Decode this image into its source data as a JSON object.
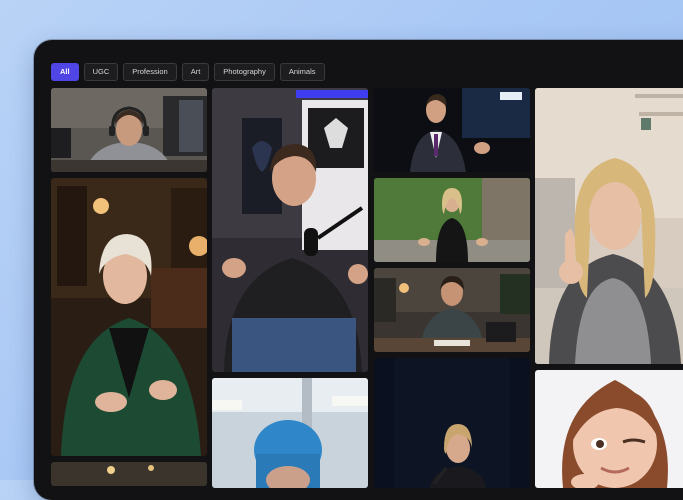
{
  "filters": [
    {
      "label": "All",
      "active": true
    },
    {
      "label": "UGC",
      "active": false
    },
    {
      "label": "Profession",
      "active": false
    },
    {
      "label": "Art",
      "active": false
    },
    {
      "label": "Photography",
      "active": false
    },
    {
      "label": "Animals",
      "active": false
    }
  ],
  "gallery": {
    "column_1": [
      "man-with-headset-at-desk",
      "older-woman-in-green-blazer-in-library",
      "dim-interior-bottom"
    ],
    "column_2": [
      "young-man-podcaster-with-microphone",
      "person-in-surgical-cap-in-operating-room"
    ],
    "column_3": [
      "man-in-suit-speaking-on-stage",
      "woman-in-black-dress-in-front-of-hedge",
      "man-at-desk-in-office",
      "woman-speaking-at-podium"
    ],
    "column_4": [
      "blonde-woman-selfie-in-bedroom",
      "3d-cartoon-woman-character"
    ]
  },
  "colors": {
    "accent": "#4f46e5",
    "frame": "#121214",
    "background": "#a9c8f5"
  }
}
